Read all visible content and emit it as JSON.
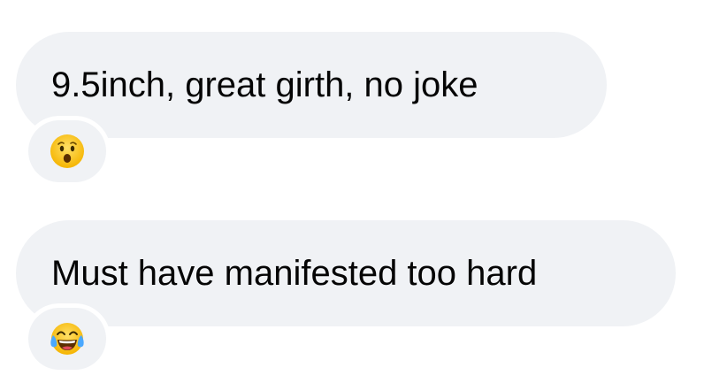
{
  "messages": [
    {
      "text": "9.5inch, great girth, no joke",
      "reaction": {
        "icon": "astonished-face-icon",
        "glyph": "😮"
      }
    },
    {
      "text": "Must have manifested too hard",
      "reaction": {
        "icon": "face-with-tears-of-joy-icon",
        "glyph": "😂"
      }
    }
  ],
  "colors": {
    "bubble": "#f0f2f5",
    "text": "#050505",
    "background": "#ffffff",
    "emoji_face": "#ffcc33",
    "emoji_outline": "#e0a100",
    "tears": "#4aa8ff"
  }
}
